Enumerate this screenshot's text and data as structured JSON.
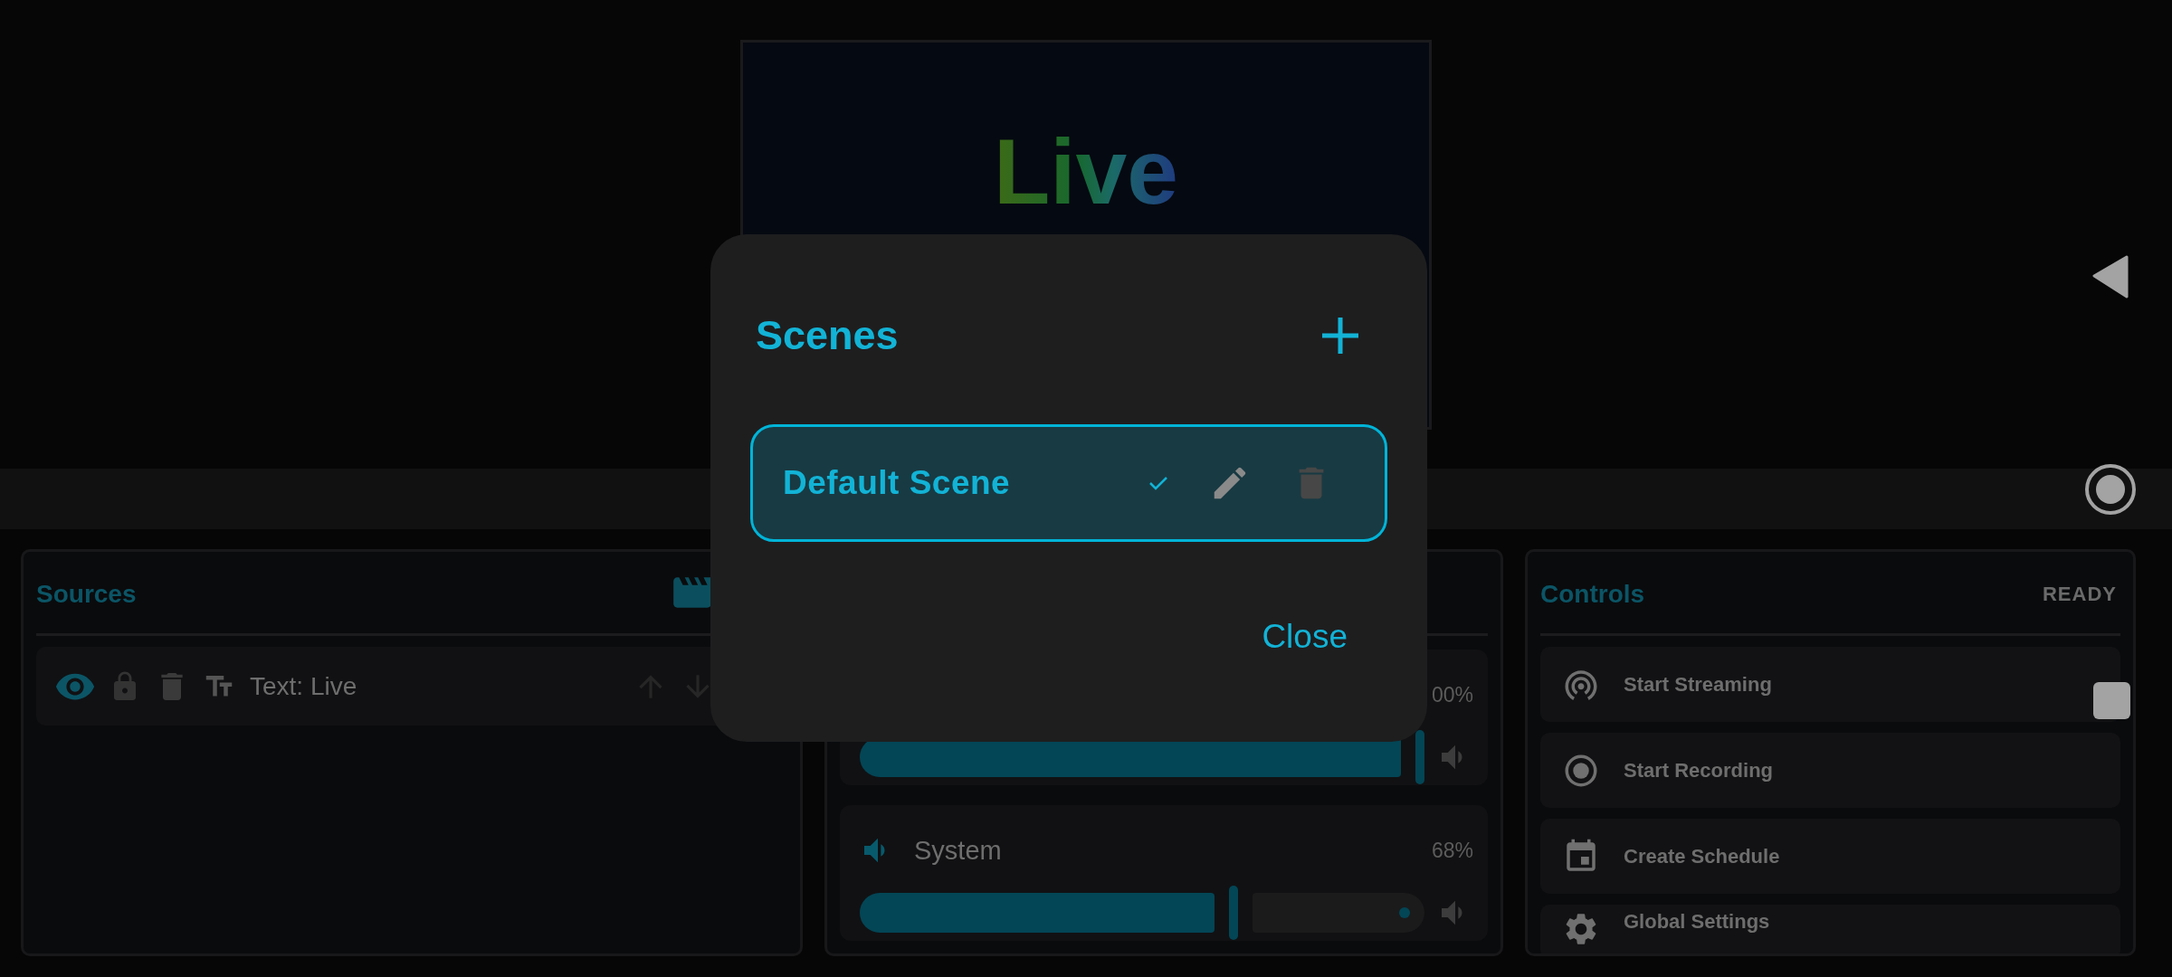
{
  "preview": {
    "text": "Live"
  },
  "sources": {
    "title": "Sources",
    "items": [
      {
        "label": "Text: Live",
        "visible": true,
        "locked": false
      }
    ]
  },
  "mixer": {
    "channels": [
      {
        "reading": "00%",
        "level": 1
      },
      {
        "name": "System",
        "reading": "68%",
        "level": 0.68
      }
    ]
  },
  "controls": {
    "title": "Controls",
    "status": "READY",
    "items": [
      {
        "kind": "stream",
        "label": "Start Streaming"
      },
      {
        "kind": "record",
        "label": "Start Recording"
      },
      {
        "kind": "schedule",
        "label": "Create Schedule"
      },
      {
        "kind": "settings",
        "label": "Global Settings"
      }
    ]
  },
  "scenes_dialog": {
    "title": "Scenes",
    "scenes": [
      {
        "name": "Default Scene",
        "selected": true,
        "deletable": false
      }
    ],
    "close": "Close"
  }
}
